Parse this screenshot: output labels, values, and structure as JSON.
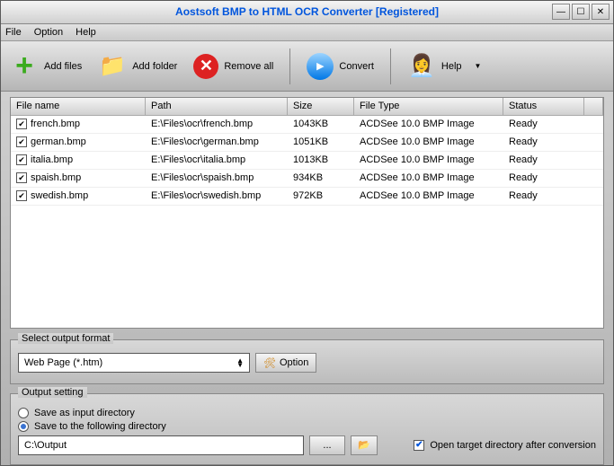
{
  "window": {
    "title": "Aostsoft BMP to HTML OCR Converter [Registered]"
  },
  "menubar": {
    "file": "File",
    "option": "Option",
    "help": "Help"
  },
  "toolbar": {
    "add_files": "Add files",
    "add_folder": "Add folder",
    "remove_all": "Remove all",
    "convert": "Convert",
    "help": "Help"
  },
  "grid": {
    "headers": {
      "file_name": "File name",
      "path": "Path",
      "size": "Size",
      "file_type": "File Type",
      "status": "Status"
    },
    "rows": [
      {
        "checked": true,
        "file_name": "french.bmp",
        "path": "E:\\Files\\ocr\\french.bmp",
        "size": "1043KB",
        "file_type": "ACDSee 10.0 BMP Image",
        "status": "Ready"
      },
      {
        "checked": true,
        "file_name": "german.bmp",
        "path": "E:\\Files\\ocr\\german.bmp",
        "size": "1051KB",
        "file_type": "ACDSee 10.0 BMP Image",
        "status": "Ready"
      },
      {
        "checked": true,
        "file_name": "italia.bmp",
        "path": "E:\\Files\\ocr\\italia.bmp",
        "size": "1013KB",
        "file_type": "ACDSee 10.0 BMP Image",
        "status": "Ready"
      },
      {
        "checked": true,
        "file_name": "spaish.bmp",
        "path": "E:\\Files\\ocr\\spaish.bmp",
        "size": "934KB",
        "file_type": "ACDSee 10.0 BMP Image",
        "status": "Ready"
      },
      {
        "checked": true,
        "file_name": "swedish.bmp",
        "path": "E:\\Files\\ocr\\swedish.bmp",
        "size": "972KB",
        "file_type": "ACDSee 10.0 BMP Image",
        "status": "Ready"
      }
    ]
  },
  "format_section": {
    "title": "Select output format",
    "selected": "Web Page (*.htm)",
    "option_button": "Option"
  },
  "output_section": {
    "title": "Output setting",
    "save_as_input": "Save as input directory",
    "save_to_following": "Save to the following directory",
    "path": "C:\\Output",
    "browse": "...",
    "open_target": "Open target directory after conversion"
  }
}
